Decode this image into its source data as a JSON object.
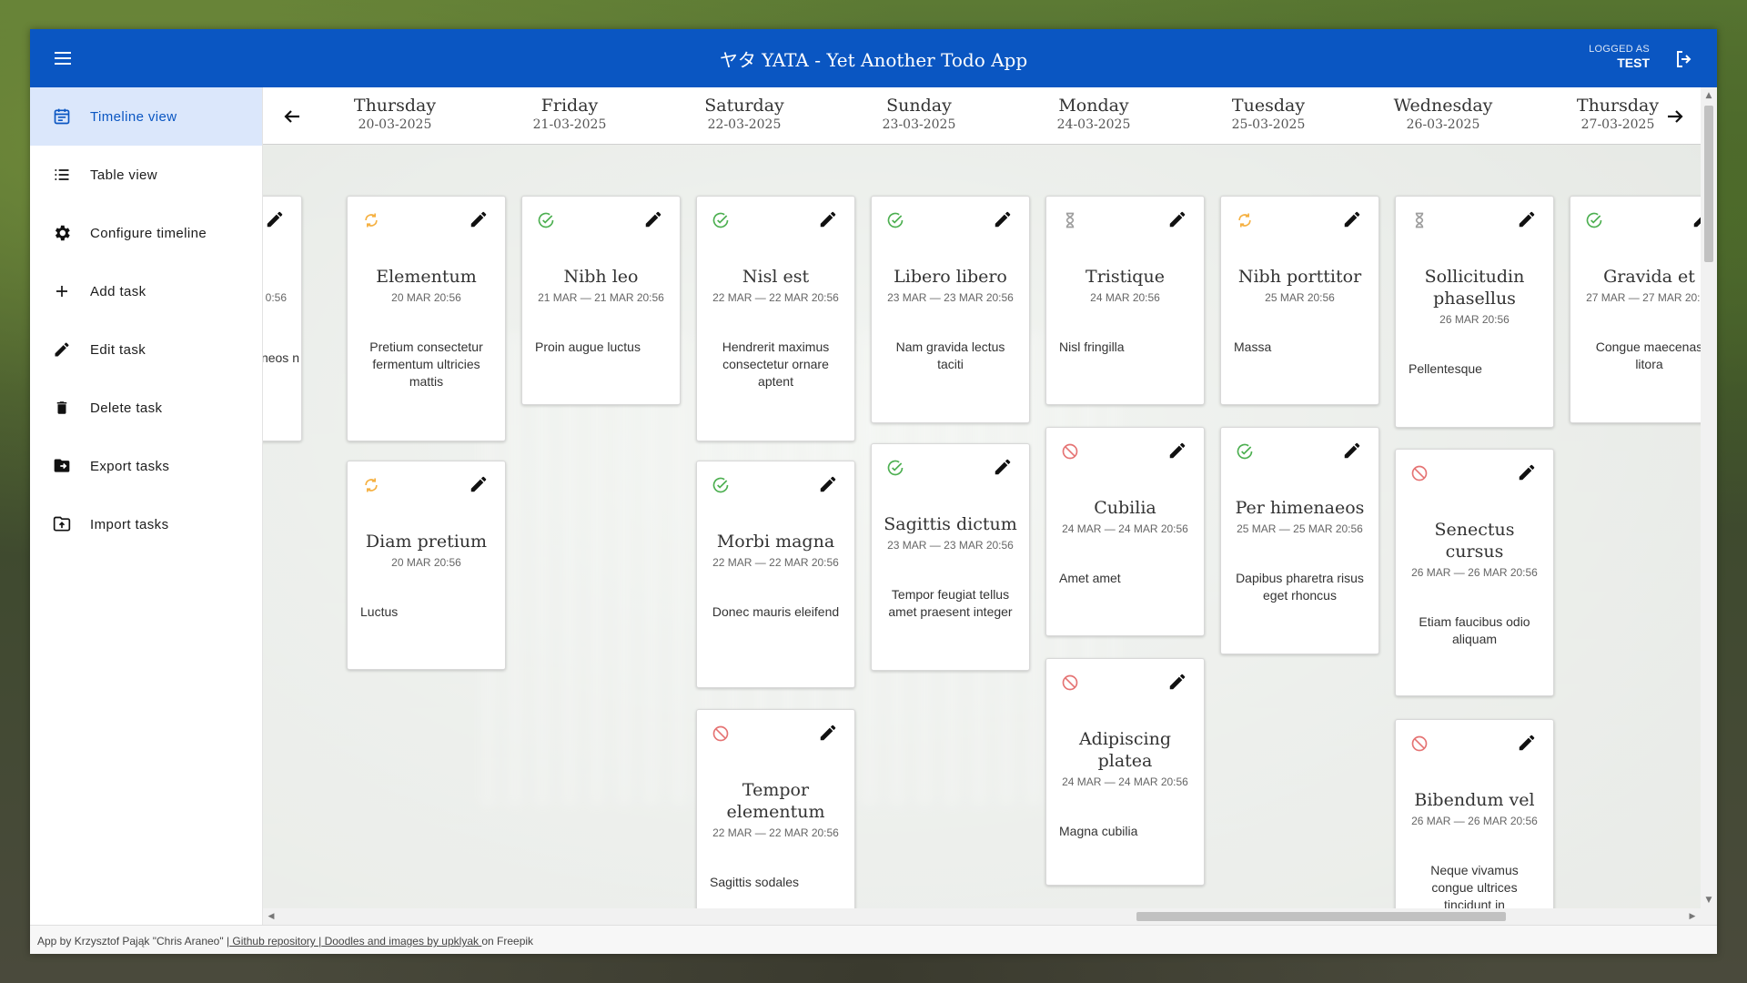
{
  "header": {
    "title": "ヤタ YATA - Yet Another Todo App",
    "logged_as_label": "LOGGED AS",
    "username": "TEST"
  },
  "sidebar": {
    "items": [
      {
        "label": "Timeline view",
        "icon": "calendar-icon"
      },
      {
        "label": "Table view",
        "icon": "list-icon"
      },
      {
        "label": "Configure timeline",
        "icon": "gear-icon"
      },
      {
        "label": "Add task",
        "icon": "plus-icon"
      },
      {
        "label": "Edit task",
        "icon": "pencil-icon"
      },
      {
        "label": "Delete task",
        "icon": "trash-icon"
      },
      {
        "label": "Export tasks",
        "icon": "export-icon"
      },
      {
        "label": "Import tasks",
        "icon": "import-icon"
      }
    ]
  },
  "days": [
    {
      "name": "Thursday",
      "date": "20-03-2025"
    },
    {
      "name": "Friday",
      "date": "21-03-2025"
    },
    {
      "name": "Saturday",
      "date": "22-03-2025"
    },
    {
      "name": "Sunday",
      "date": "23-03-2025"
    },
    {
      "name": "Monday",
      "date": "24-03-2025"
    },
    {
      "name": "Tuesday",
      "date": "25-03-2025"
    },
    {
      "name": "Wednesday",
      "date": "26-03-2025"
    },
    {
      "name": "Thursday",
      "date": "27-03-2025"
    }
  ],
  "partial_card": {
    "date": "0:56",
    "desc": "neos n"
  },
  "tasks": {
    "c0a": {
      "status": "in-progress",
      "title": "Elementum",
      "date": "20 MAR 20:56",
      "desc": "Pretium consectetur fermentum ultricies mattis"
    },
    "c0b": {
      "status": "in-progress",
      "title": "Diam pretium",
      "date": "20 MAR 20:56",
      "desc": "Luctus"
    },
    "c1a": {
      "status": "done",
      "title": "Nibh leo",
      "date": "21 MAR — 21 MAR 20:56",
      "desc": "Proin augue luctus"
    },
    "c2a": {
      "status": "done",
      "title": "Nisl est",
      "date": "22 MAR — 22 MAR 20:56",
      "desc": "Hendrerit maximus consectetur ornare aptent"
    },
    "c2b": {
      "status": "done",
      "title": "Morbi magna",
      "date": "22 MAR — 22 MAR 20:56",
      "desc": "Donec mauris eleifend"
    },
    "c2c": {
      "status": "cancelled",
      "title": "Tempor elementum",
      "date": "22 MAR — 22 MAR 20:56",
      "desc": "Sagittis sodales"
    },
    "c3a": {
      "status": "done",
      "title": "Libero libero",
      "date": "23 MAR — 23 MAR 20:56",
      "desc": "Nam gravida lectus taciti"
    },
    "c3b": {
      "status": "done",
      "title": "Sagittis dictum",
      "date": "23 MAR — 23 MAR 20:56",
      "desc": "Tempor feugiat tellus amet praesent integer"
    },
    "c4a": {
      "status": "pending",
      "title": "Tristique",
      "date": "24 MAR 20:56",
      "desc": "Nisl fringilla"
    },
    "c4b": {
      "status": "cancelled",
      "title": "Cubilia",
      "date": "24 MAR — 24 MAR 20:56",
      "desc": "Amet amet"
    },
    "c4c": {
      "status": "cancelled",
      "title": "Adipiscing platea",
      "date": "24 MAR — 24 MAR 20:56",
      "desc": "Magna cubilia"
    },
    "c5a": {
      "status": "in-progress",
      "title": "Nibh porttitor",
      "date": "25 MAR 20:56",
      "desc": "Massa"
    },
    "c5b": {
      "status": "done",
      "title": "Per himenaeos",
      "date": "25 MAR — 25 MAR 20:56",
      "desc": "Dapibus pharetra risus eget rhoncus"
    },
    "c6a": {
      "status": "pending",
      "title": "Sollicitudin phasellus",
      "date": "26 MAR 20:56",
      "desc": "Pellentesque"
    },
    "c6b": {
      "status": "cancelled",
      "title": "Senectus cursus",
      "date": "26 MAR — 26 MAR 20:56",
      "desc": "Etiam faucibus odio aliquam"
    },
    "c6c": {
      "status": "cancelled",
      "title": "Bibendum vel",
      "date": "26 MAR — 26 MAR 20:56",
      "desc": "Neque vivamus congue ultrices tincidunt in"
    },
    "c7a": {
      "status": "done",
      "title": "Gravida et",
      "date": "27 MAR — 27 MAR 20:56",
      "desc": "Congue maecenas litora"
    }
  },
  "footer": {
    "credit": "App by Krzysztof Pająk \"Chris Araneo\" |",
    "repo_link": " Github repository ",
    "sep": "|",
    "doodles_link": " Doodles and images by upklyak ",
    "tail": "on Freepik"
  },
  "colors": {
    "primary": "#0a56c2",
    "done": "#4caf50",
    "in_progress": "#f5b041",
    "cancelled": "#e57373",
    "pending": "#9e9e9e"
  }
}
